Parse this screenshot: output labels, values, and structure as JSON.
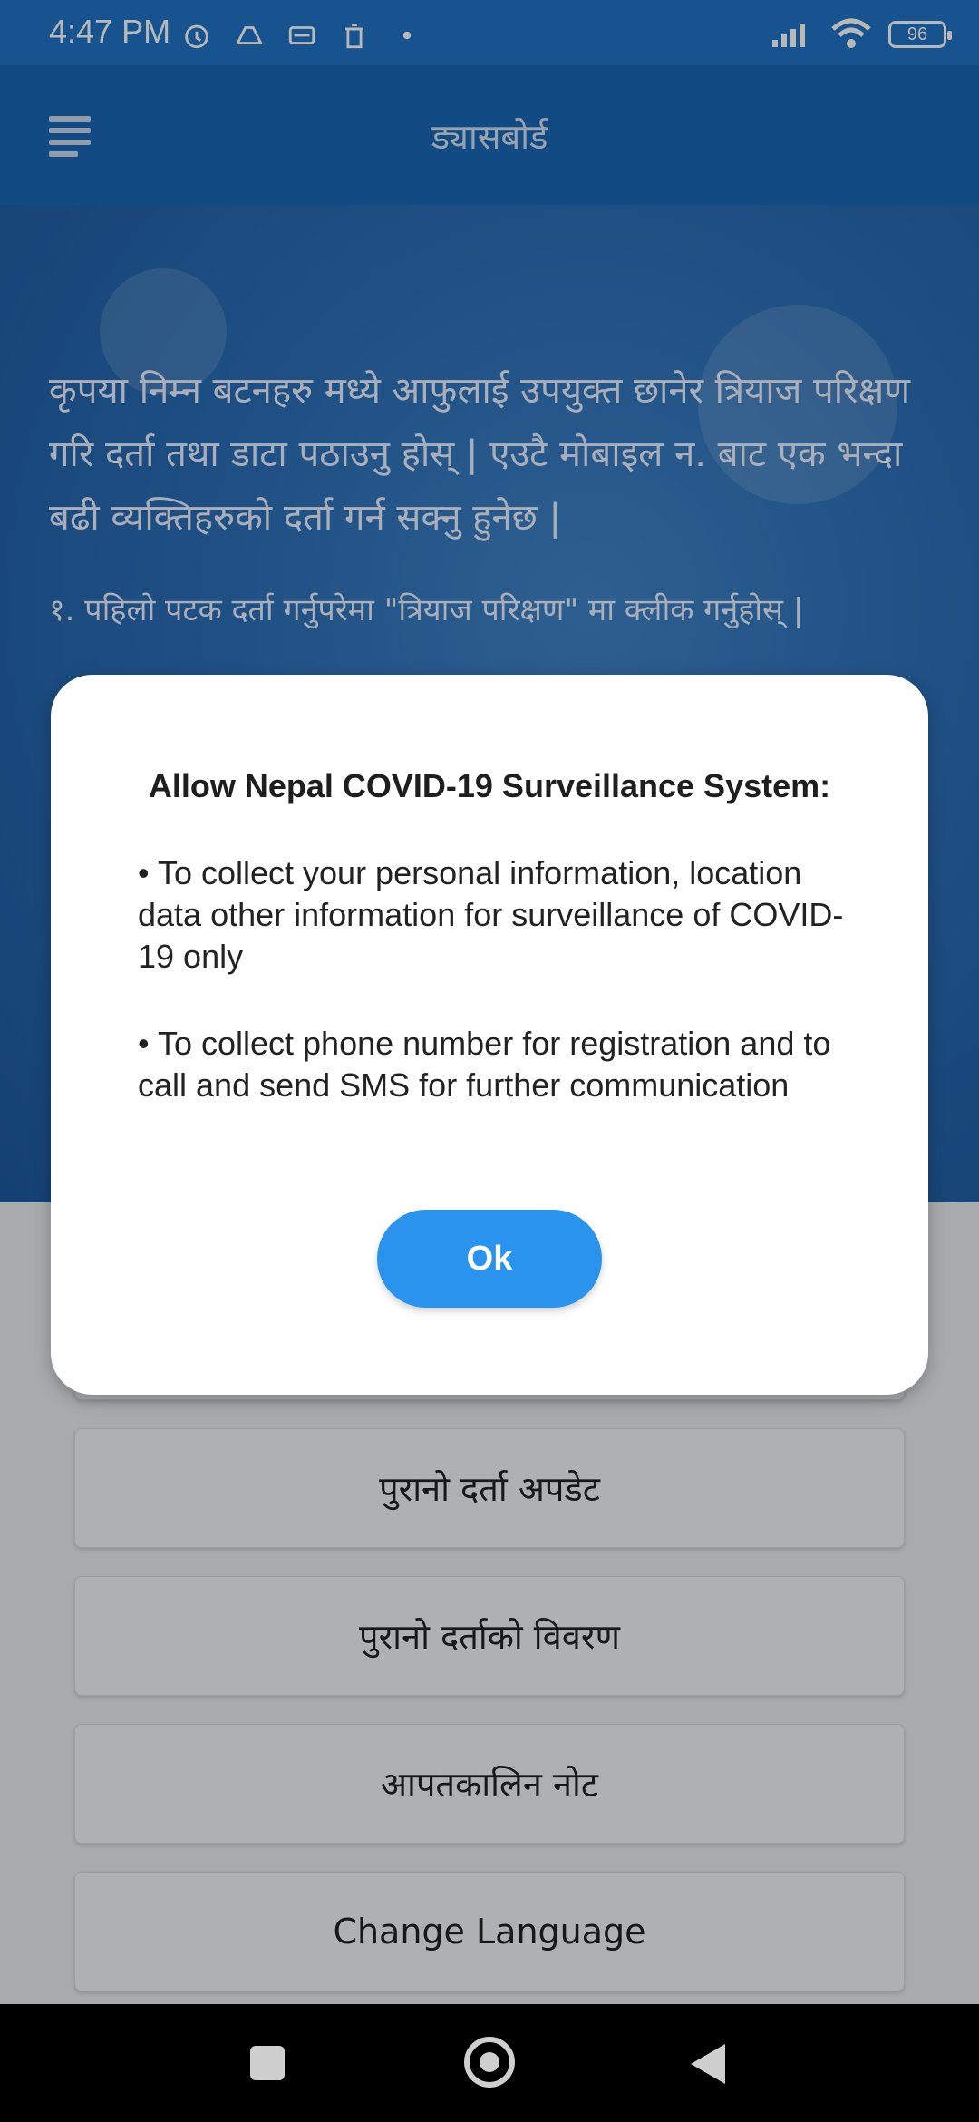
{
  "status_bar": {
    "time": "4:47 PM",
    "battery_level": "96"
  },
  "toolbar": {
    "title": "ड्यासबोर्ड"
  },
  "hero": {
    "intro_text": "कृपया निम्न बटनहरु मध्ये आफुलाई उपयुक्त छानेर त्रियाज परिक्षण गरि दर्ता तथा डाटा पठाउनु होस् |  एउटै मोबाइल न. बाट एक भन्दा बढी व्यक्तिहरुको दर्ता गर्न सक्नु हुनेछ |",
    "step1_text": "१. पहिलो पटक दर्ता गर्नुपरेमा \"त्रियाज परिक्षण\" मा क्लीक गर्नुहोस् |"
  },
  "buttons": {
    "old_registration_update": "पुरानो दर्ता अपडेट",
    "old_registration_details": "पुरानो दर्ताको विवरण",
    "emergency_note": "आपतकालिन नोट",
    "change_language": "Change Language"
  },
  "dialog": {
    "title": "Allow Nepal COVID-19 Surveillance System:",
    "bullet_1": "• To collect your personal information, location data other information for surveillance of COVID-19 only",
    "bullet_2": "• To collect phone number for registration and to call and send SMS for further communication",
    "ok_label": "Ok"
  },
  "colors": {
    "status_bar": "#1f73c6",
    "toolbar": "#1a69b8",
    "ok_button": "#2a93ee"
  }
}
